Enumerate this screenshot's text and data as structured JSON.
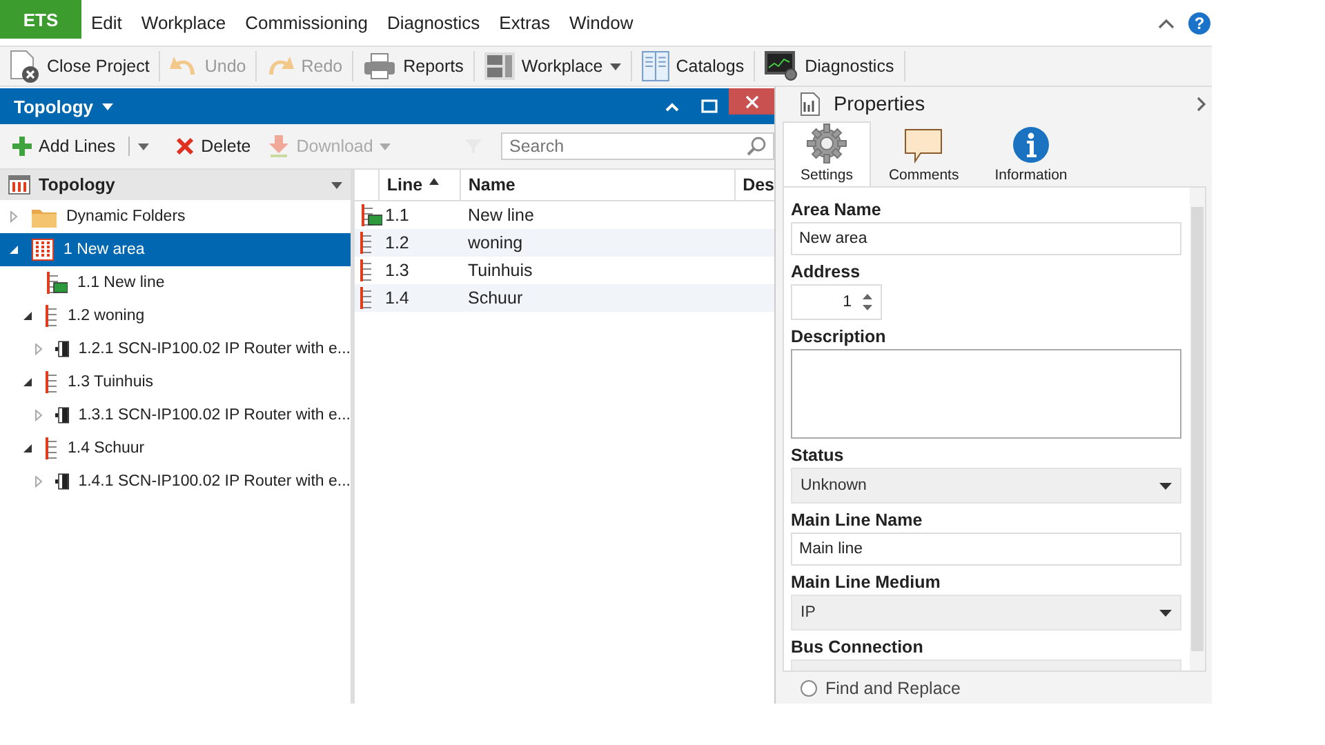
{
  "menu_bar": {
    "app_button": "ETS",
    "items": [
      "Edit",
      "Workplace",
      "Commissioning",
      "Diagnostics",
      "Extras",
      "Window"
    ],
    "help_glyph": "?"
  },
  "toolbar": [
    {
      "kind": "close",
      "label": "Close Project",
      "disabled": false,
      "dropdown": false
    },
    {
      "kind": "undo",
      "label": "Undo",
      "disabled": true,
      "dropdown": false
    },
    {
      "kind": "redo",
      "label": "Redo",
      "disabled": true,
      "dropdown": false
    },
    {
      "kind": "print",
      "label": "Reports",
      "disabled": false,
      "dropdown": false
    },
    {
      "kind": "workplace",
      "label": "Workplace",
      "disabled": false,
      "dropdown": true
    },
    {
      "kind": "catalog",
      "label": "Catalogs",
      "disabled": false,
      "dropdown": false
    },
    {
      "kind": "diagnostics",
      "label": "Diagnostics",
      "disabled": false,
      "dropdown": false
    }
  ],
  "topology_panel": {
    "title": "Topology",
    "actions": [
      {
        "kind": "add",
        "label": "Add Lines",
        "disabled": false
      },
      {
        "kind": "delete",
        "label": "Delete",
        "disabled": false
      },
      {
        "kind": "download",
        "label": "Download",
        "disabled": true
      }
    ],
    "search": {
      "placeholder": "Search"
    },
    "tree": {
      "header": "Topology",
      "items": [
        {
          "kind": "folder",
          "label": "Dynamic Folders",
          "expanded": false,
          "selected": false
        },
        {
          "kind": "area",
          "label": "1 New area",
          "expanded": true,
          "selected": true,
          "children": [
            {
              "kind": "line-active",
              "label": "1.1 New line",
              "selected": false
            },
            {
              "kind": "line",
              "label": "1.2 woning",
              "expanded": true,
              "selected": false,
              "children": [
                {
                  "kind": "device",
                  "label": "1.2.1 SCN-IP100.02 IP Router with e...",
                  "expanded": false,
                  "selected": false
                }
              ]
            },
            {
              "kind": "line",
              "label": "1.3 Tuinhuis",
              "expanded": true,
              "selected": false,
              "children": [
                {
                  "kind": "device",
                  "label": "1.3.1 SCN-IP100.02 IP Router with e...",
                  "expanded": false,
                  "selected": false
                }
              ]
            },
            {
              "kind": "line",
              "label": "1.4 Schuur",
              "expanded": true,
              "selected": false,
              "children": [
                {
                  "kind": "device",
                  "label": "1.4.1 SCN-IP100.02 IP Router with e...",
                  "expanded": false,
                  "selected": false
                }
              ]
            }
          ]
        }
      ]
    },
    "table": {
      "columns": [
        {
          "label": "Line",
          "sorted": true
        },
        {
          "label": "Name",
          "sorted": false
        },
        {
          "label": "Des",
          "sorted": false
        }
      ],
      "rows": [
        {
          "kind": "line-active",
          "line": "1.1",
          "name": "New line"
        },
        {
          "kind": "line",
          "line": "1.2",
          "name": "woning"
        },
        {
          "kind": "line",
          "line": "1.3",
          "name": "Tuinhuis"
        },
        {
          "kind": "line",
          "line": "1.4",
          "name": "Schuur"
        }
      ]
    }
  },
  "properties": {
    "title": "Properties",
    "tabs": [
      {
        "kind": "settings",
        "label": "Settings",
        "selected": true
      },
      {
        "kind": "comments",
        "label": "Comments",
        "selected": false
      },
      {
        "kind": "information",
        "label": "Information",
        "selected": false
      }
    ],
    "fields": [
      {
        "kind": "text",
        "label": "Area Name",
        "value": "New area"
      },
      {
        "kind": "spinner",
        "label": "Address",
        "value": "1"
      },
      {
        "kind": "textarea",
        "label": "Description"
      },
      {
        "kind": "select",
        "label": "Status",
        "value": "Unknown"
      },
      {
        "kind": "text",
        "label": "Main Line Name",
        "value": "Main line"
      },
      {
        "kind": "select",
        "label": "Main Line Medium",
        "value": "IP"
      },
      {
        "kind": "select",
        "label": "Bus Connection"
      }
    ],
    "find_option": {
      "label": "Find and Replace",
      "selected": false
    }
  }
}
